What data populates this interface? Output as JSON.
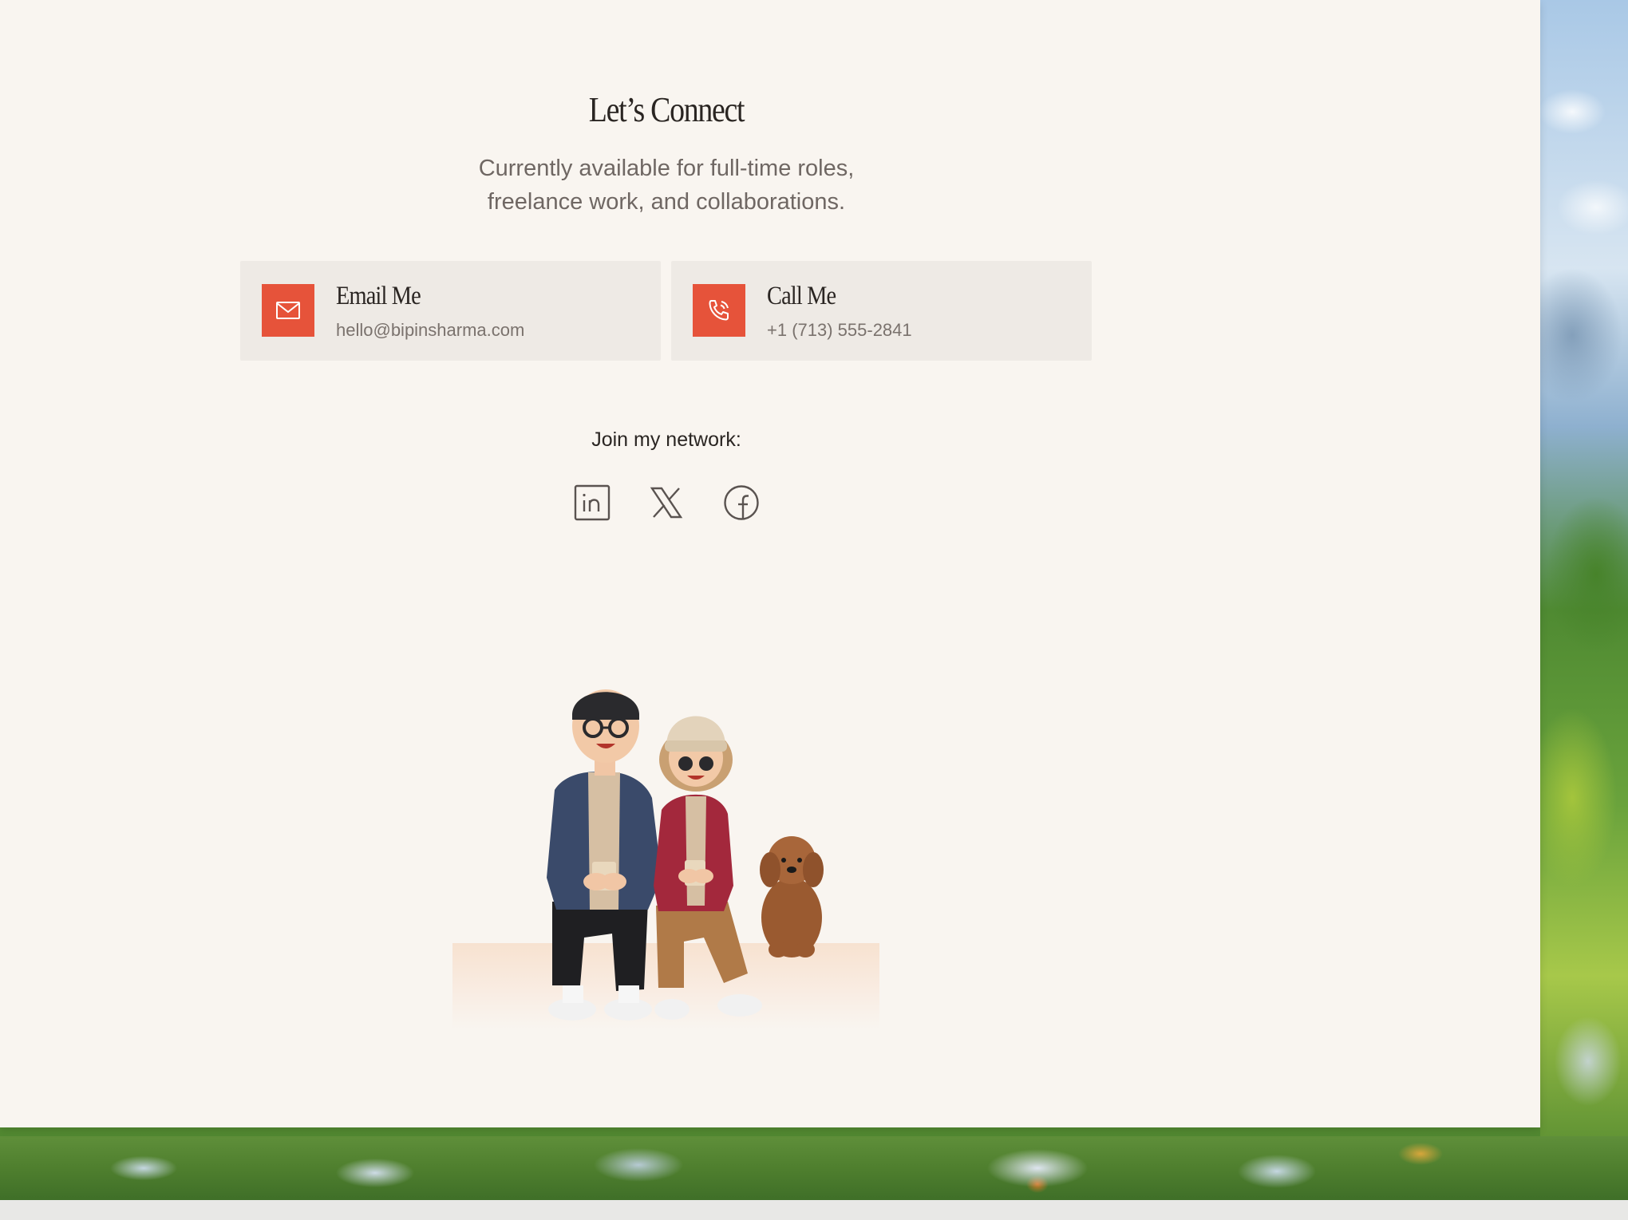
{
  "contact": {
    "title": "Let’s Connect",
    "subtitle_line1": "Currently available for full-time roles,",
    "subtitle_line2": "freelance work, and collaborations.",
    "email_card": {
      "label": "Email Me",
      "value": "hello@bipinsharma.com",
      "icon": "mail-icon"
    },
    "call_card": {
      "label": "Call Me",
      "value": "+1 (713) 555-2841",
      "icon": "phone-icon"
    },
    "network_label": "Join my network:",
    "social_links": [
      {
        "name": "LinkedIn",
        "icon": "linkedin-icon"
      },
      {
        "name": "X",
        "icon": "x-icon"
      },
      {
        "name": "Facebook",
        "icon": "facebook-icon"
      }
    ]
  },
  "colors": {
    "page_background": "#f9f5f0",
    "card_background": "#eeeae5",
    "accent": "#e6533a",
    "heading": "#2a2522",
    "muted_text": "#6f6763"
  }
}
